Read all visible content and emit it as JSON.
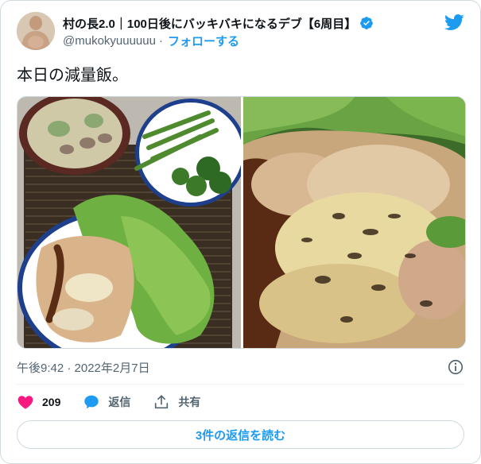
{
  "user": {
    "display_name": "村の長2.0｜100日後にバッキバキになるデブ【6周目】",
    "handle": "@mukokyuuuuuu",
    "separator": "·",
    "follow_label": "フォローする",
    "verified_icon": "verified-badge-icon",
    "avatar_icon": "avatar"
  },
  "tweet": {
    "text": "本日の減量飯。",
    "timestamp": "午後9:42 · 2022年2月7日"
  },
  "actions": {
    "like_count": "209",
    "reply_label": "返信",
    "share_label": "共有"
  },
  "footer": {
    "read_replies_label": "3件の返信を読む"
  },
  "colors": {
    "accent": "#1d9bf0",
    "like": "#f91880",
    "muted": "#536471"
  }
}
